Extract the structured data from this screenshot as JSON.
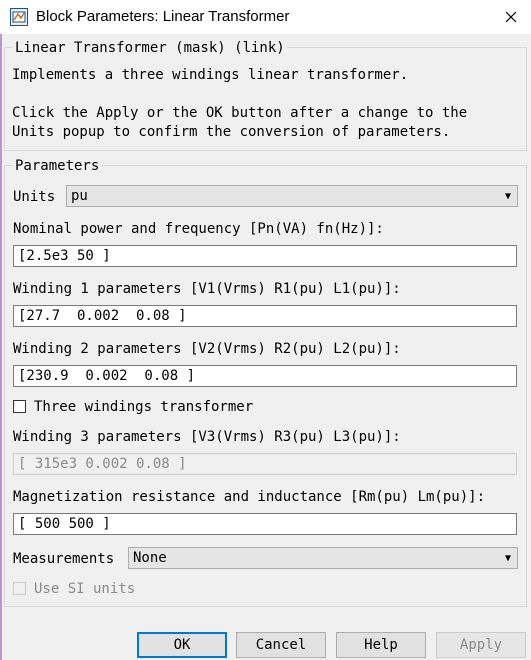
{
  "window": {
    "title": "Block Parameters: Linear Transformer"
  },
  "description": {
    "legend": "Linear Transformer (mask) (link)",
    "line1": "Implements a three windings linear transformer.",
    "line2": "Click the Apply or the OK button after a change to the",
    "line3": "Units popup to confirm the conversion of parameters."
  },
  "parameters": {
    "legend": "Parameters",
    "units_label": "Units",
    "units_value": "pu",
    "nominal_label": "Nominal power and frequency [Pn(VA) fn(Hz)]:",
    "nominal_value": "[2.5e3 50 ]",
    "w1_label": "Winding 1 parameters [V1(Vrms) R1(pu) L1(pu)]:",
    "w1_value": "[27.7  0.002  0.08 ]",
    "w2_label": "Winding 2 parameters [V2(Vrms) R2(pu) L2(pu)]:",
    "w2_value": "[230.9  0.002  0.08 ]",
    "three_windings_label": "Three windings transformer",
    "three_windings_checked": false,
    "w3_label": "Winding 3 parameters [V3(Vrms) R3(pu) L3(pu)]:",
    "w3_value": "[ 315e3 0.002 0.08 ]",
    "mag_label": "Magnetization resistance and inductance [Rm(pu) Lm(pu)]:",
    "mag_value": "[ 500 500 ]",
    "measurements_label": "Measurements",
    "measurements_value": "None",
    "si_units_label": "Use SI units",
    "si_units_checked": false
  },
  "buttons": {
    "ok": "OK",
    "cancel": "Cancel",
    "help": "Help",
    "apply": "Apply"
  },
  "colors": {
    "accent": "#0078d7",
    "disabled_text": "#8a8a8a"
  }
}
